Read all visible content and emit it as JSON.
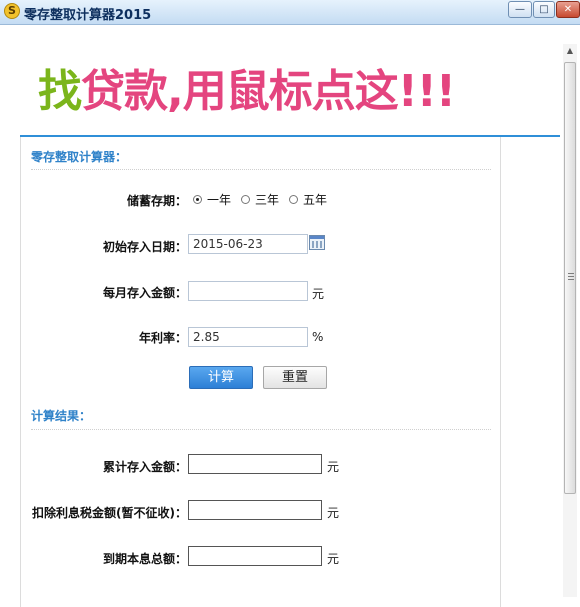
{
  "window": {
    "title": "零存整取计算器2015",
    "icon_glyph": "S",
    "controls": {
      "minimize": "—",
      "maximize": "□",
      "close": "✕"
    }
  },
  "banner": {
    "part1": "找",
    "part2": "贷款,用鼠标点这!!!",
    "colors": {
      "part1": "#7bb51b",
      "part2": "#e4457f"
    }
  },
  "calculator": {
    "section_title": "零存整取计算器：",
    "term": {
      "label": "储蓄存期：",
      "options": [
        "一年",
        "三年",
        "五年"
      ],
      "selected": "一年"
    },
    "start_date": {
      "label": "初始存入日期：",
      "value": "2015-06-23"
    },
    "monthly_amount": {
      "label": "每月存入金额：",
      "value": "",
      "unit": "元"
    },
    "annual_rate": {
      "label": "年利率：",
      "value": "2.85",
      "unit": "%"
    },
    "buttons": {
      "calculate": "计算",
      "reset": "重置"
    }
  },
  "results": {
    "section_title": "计算结果：",
    "total_deposit": {
      "label": "累计存入金额：",
      "value": "",
      "unit": "元"
    },
    "interest_after_tax": {
      "label": "扣除利息税金额(暂不征收)：",
      "value": "",
      "unit": "元"
    },
    "maturity_total": {
      "label": "到期本息总额：",
      "value": "",
      "unit": "元"
    }
  },
  "accent_color": "#2f8fd8"
}
